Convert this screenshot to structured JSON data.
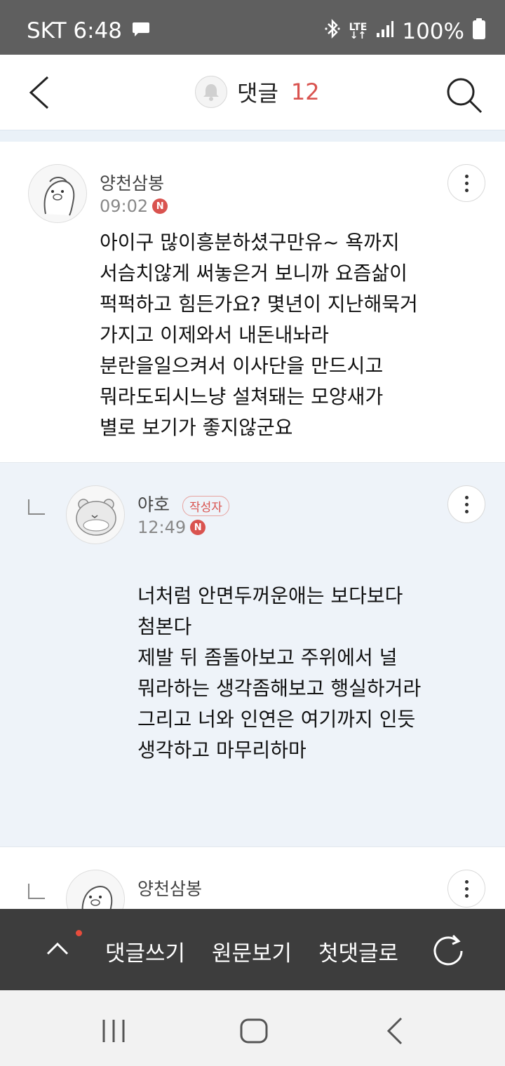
{
  "status_bar": {
    "carrier_time": "SKT 6:48",
    "battery": "100%",
    "network": "LTE",
    "icons": [
      "chat-bubble-icon",
      "bluetooth-icon",
      "lte-icon",
      "signal-icon",
      "battery-icon"
    ]
  },
  "header": {
    "title": "댓글",
    "count": "12",
    "icons": [
      "back-arrow-icon",
      "bell-icon",
      "search-icon"
    ]
  },
  "comments": [
    {
      "author": "양천삼봉",
      "time": "09:02",
      "badge": "N",
      "body": [
        "아이구 많이흥분하셨구만유~ 욕까지",
        "서슴치않게 써놓은거 보니까 요즘삶이",
        "퍽퍽하고 힘든가요? 몇년이 지난해묵거",
        "가지고 이제와서 내돈내놔라",
        "분란을일으켜서 이사단을 만드시고",
        "뭐라도되시느냥 설쳐돼는 모양새가",
        "별로 보기가 좋지않군요"
      ]
    },
    {
      "author": "야호",
      "writer_badge": "작성자",
      "time": "12:49",
      "badge": "N",
      "body": [
        "너처럼 안면두꺼운애는 보다보다",
        "첨본다",
        "제발 뒤 좀돌아보고 주위에서 널",
        "뭐라하는 생각좀해보고 행실하거라",
        "그리고 너와 인연은 여기까지 인듯",
        "생각하고 마무리하마"
      ]
    },
    {
      "author": "양천삼봉"
    }
  ],
  "action_bar": {
    "write": "댓글쓰기",
    "original": "원문보기",
    "first": "첫댓글로",
    "icons": [
      "chevron-up-icon",
      "refresh-icon"
    ]
  },
  "colors": {
    "accent": "#d9534f",
    "status_bar": "#5f5f5f",
    "action_bar": "#3d3d3d",
    "reply_bg": "#eef3f9"
  }
}
